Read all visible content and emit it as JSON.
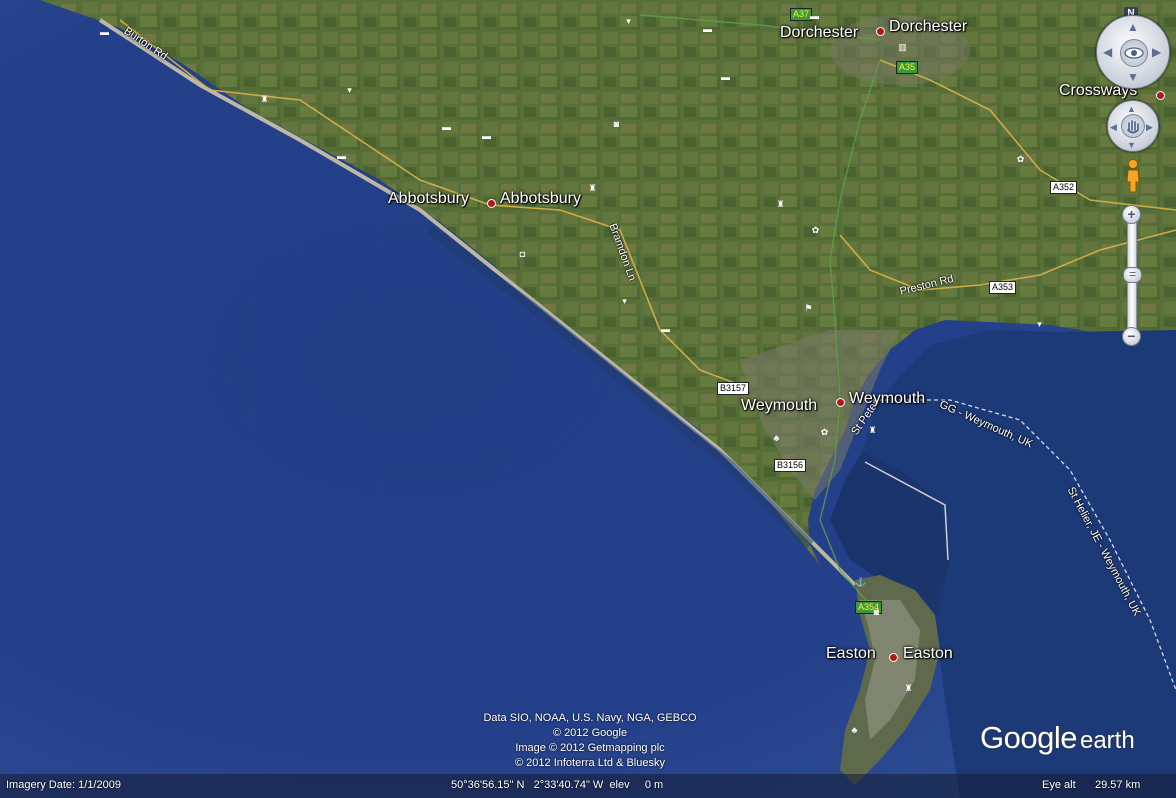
{
  "places": {
    "dorchester_1": "Dorchester",
    "dorchester_2": "Dorchester",
    "crossways": "Crossways",
    "abbotsbury_1": "Abbotsbury",
    "abbotsbury_2": "Abbotsbury",
    "weymouth": "Weymouth",
    "weymouth_2": "Weymouth",
    "easton_1": "Easton",
    "easton_2": "Easton"
  },
  "roads": {
    "burton_rd": "Burton Rd",
    "bramdon_ln": "Bramdon Ln",
    "preston_rd": "Preston Rd",
    "st_peter": "St Peter",
    "ferry_route_1": "GG - Weymouth, UK",
    "ferry_route_2": "St Helier, JE - Weymouth, UK"
  },
  "road_shields": {
    "a37": "A37",
    "a35": "A35",
    "a352": "A352",
    "a353": "A353",
    "b3157": "B3157",
    "b3156": "B3156",
    "a354": "A354"
  },
  "attribution": {
    "line1": "Data SIO, NOAA, U.S. Navy, NGA, GEBCO",
    "line2": "© 2012 Google",
    "line3": "Image © 2012 Getmapping plc",
    "line4": "© 2012 Infoterra Ltd & Bluesky"
  },
  "status": {
    "imagery_date": "Imagery Date: 1/1/2009",
    "coordinates": "50°36'56.15\" N   2°33'40.74\" W  elev     0 m",
    "eye_alt_label": "Eye alt",
    "eye_alt_value": "29.57 km"
  },
  "logo": {
    "google": "Google",
    "earth": "earth"
  },
  "nav": {
    "north": "N",
    "zoom_in": "+",
    "zoom_out": "−",
    "zoom_thumb": "="
  },
  "icons": {
    "look": "eye-icon",
    "move": "hand-icon",
    "street_view": "pegman-icon",
    "poi_bar": "cocktail-icon",
    "poi_hotel": "bed-icon",
    "poi_camera": "camera-icon",
    "poi_castle": "castle-icon",
    "poi_shop": "bag-icon",
    "poi_museum": "museum-icon",
    "poi_palette": "palette-icon",
    "poi_golf": "golf-icon",
    "poi_tree": "tree-icon",
    "poi_ferry": "anchor-icon"
  },
  "colors": {
    "sea": "#233f86",
    "land": "#4f6b34",
    "road": "#d9b24a"
  }
}
